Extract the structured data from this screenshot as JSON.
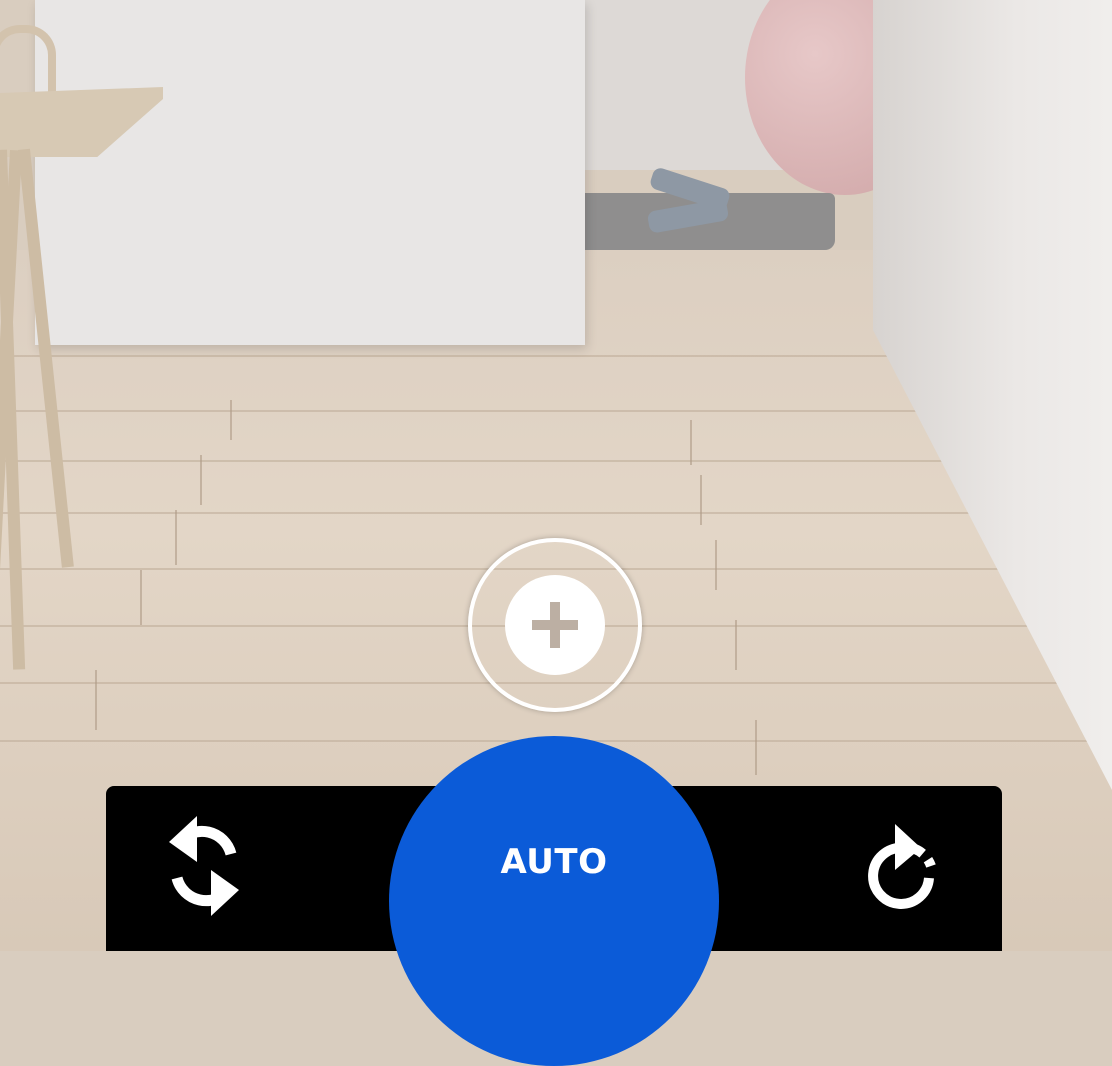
{
  "scene": {
    "description_icon": "room-camera-view"
  },
  "controls": {
    "add_button_icon": "plus-icon",
    "rotate_left_icon": "rotate-refresh-icon",
    "rotate_right_icon": "rotate-dashed-icon",
    "auto_label": "AUTO"
  },
  "colors": {
    "accent": "#0b5bd8",
    "toolbar_bg": "#000000",
    "plus_glyph": "#bcafa3"
  }
}
